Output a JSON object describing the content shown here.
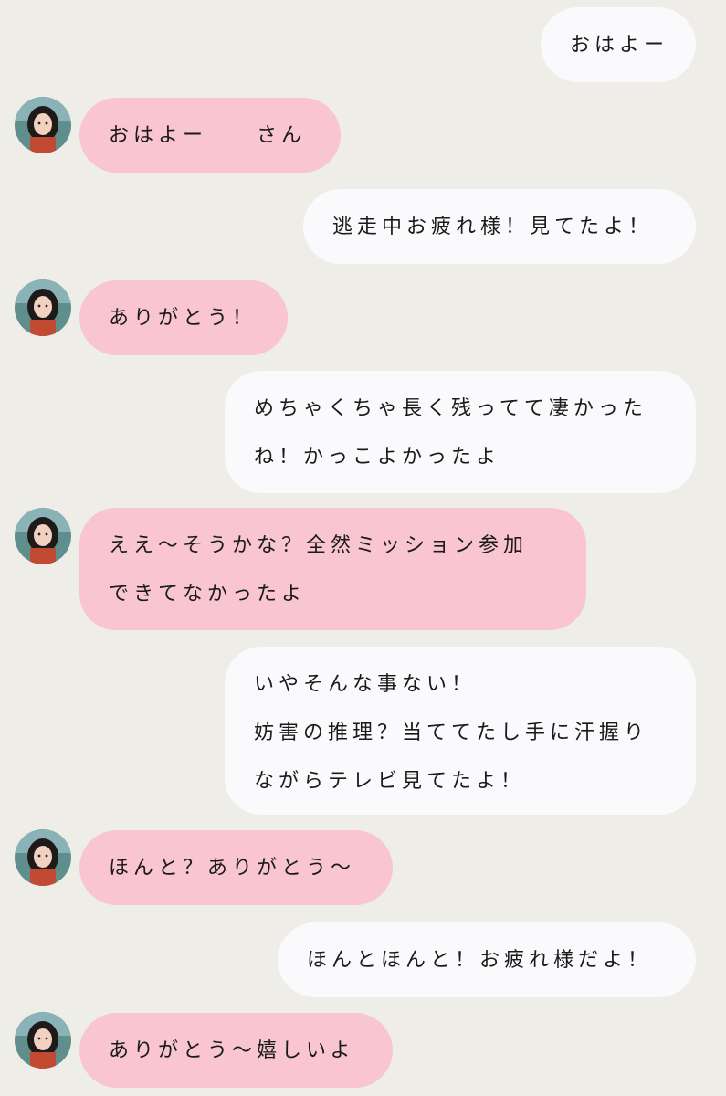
{
  "colors": {
    "background": "#efede7",
    "incoming_bubble": "#f8c5d0",
    "outgoing_bubble": "#fafafd",
    "text": "#1a1a1a"
  },
  "messages": [
    {
      "side": "right",
      "lines": [
        "おはよー"
      ]
    },
    {
      "side": "left",
      "lines": [
        "おはよー　　さん"
      ],
      "avatar": "contact-avatar"
    },
    {
      "side": "right",
      "lines": [
        "逃走中お疲れ様！見てたよ！"
      ]
    },
    {
      "side": "left",
      "lines": [
        "ありがとう！"
      ],
      "avatar": "contact-avatar"
    },
    {
      "side": "right",
      "lines": [
        "めちゃくちゃ長く残ってて凄かった",
        "ね！かっこよかったよ"
      ]
    },
    {
      "side": "left",
      "lines": [
        "ええ〜そうかな？全然ミッション参加",
        "できてなかったよ"
      ],
      "avatar": "contact-avatar"
    },
    {
      "side": "right",
      "lines": [
        "いやそんな事ない！",
        "妨害の推理？当ててたし手に汗握り",
        "ながらテレビ見てたよ！"
      ]
    },
    {
      "side": "left",
      "lines": [
        "ほんと？ありがとう〜"
      ],
      "avatar": "contact-avatar"
    },
    {
      "side": "right",
      "lines": [
        "ほんとほんと！お疲れ様だよ！"
      ]
    },
    {
      "side": "left",
      "lines": [
        "ありがとう〜嬉しいよ"
      ],
      "avatar": "contact-avatar"
    }
  ]
}
